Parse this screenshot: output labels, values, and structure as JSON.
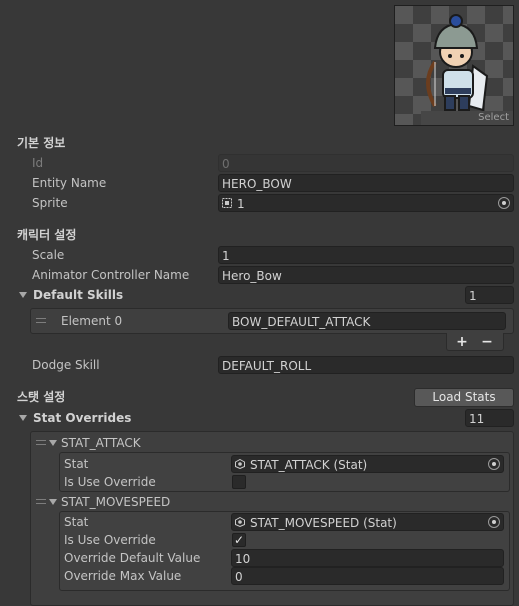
{
  "preview": {
    "select_label": "Select"
  },
  "basic_info": {
    "header": "기본 정보",
    "id_label": "Id",
    "id_value": "0",
    "entity_name_label": "Entity Name",
    "entity_name_value": "HERO_BOW",
    "sprite_label": "Sprite",
    "sprite_value": "1"
  },
  "character_settings": {
    "header": "캐릭터 설정",
    "scale_label": "Scale",
    "scale_value": "1",
    "animator_label": "Animator Controller Name",
    "animator_value": "Hero_Bow",
    "default_skills_label": "Default Skills",
    "default_skills_count": "1",
    "skills": [
      {
        "label": "Element 0",
        "value": "BOW_DEFAULT_ATTACK"
      }
    ],
    "add_label": "+",
    "remove_label": "−",
    "dodge_label": "Dodge Skill",
    "dodge_value": "DEFAULT_ROLL"
  },
  "stat_settings": {
    "header": "스탯 설정",
    "load_button": "Load Stats",
    "overrides_label": "Stat Overrides",
    "overrides_count": "11",
    "entries": [
      {
        "title": "STAT_ATTACK",
        "stat_label": "Stat",
        "stat_value": "STAT_ATTACK (Stat)",
        "use_override_label": "Is Use Override",
        "use_override": false
      },
      {
        "title": "STAT_MOVESPEED",
        "stat_label": "Stat",
        "stat_value": "STAT_MOVESPEED (Stat)",
        "use_override_label": "Is Use Override",
        "use_override": true,
        "check_glyph": "✓",
        "default_label": "Override Default Value",
        "default_value": "10",
        "max_label": "Override Max Value",
        "max_value": "0"
      }
    ]
  },
  "colors": {
    "background": "#383838",
    "field": "#2a2a2a",
    "button": "#585858"
  }
}
